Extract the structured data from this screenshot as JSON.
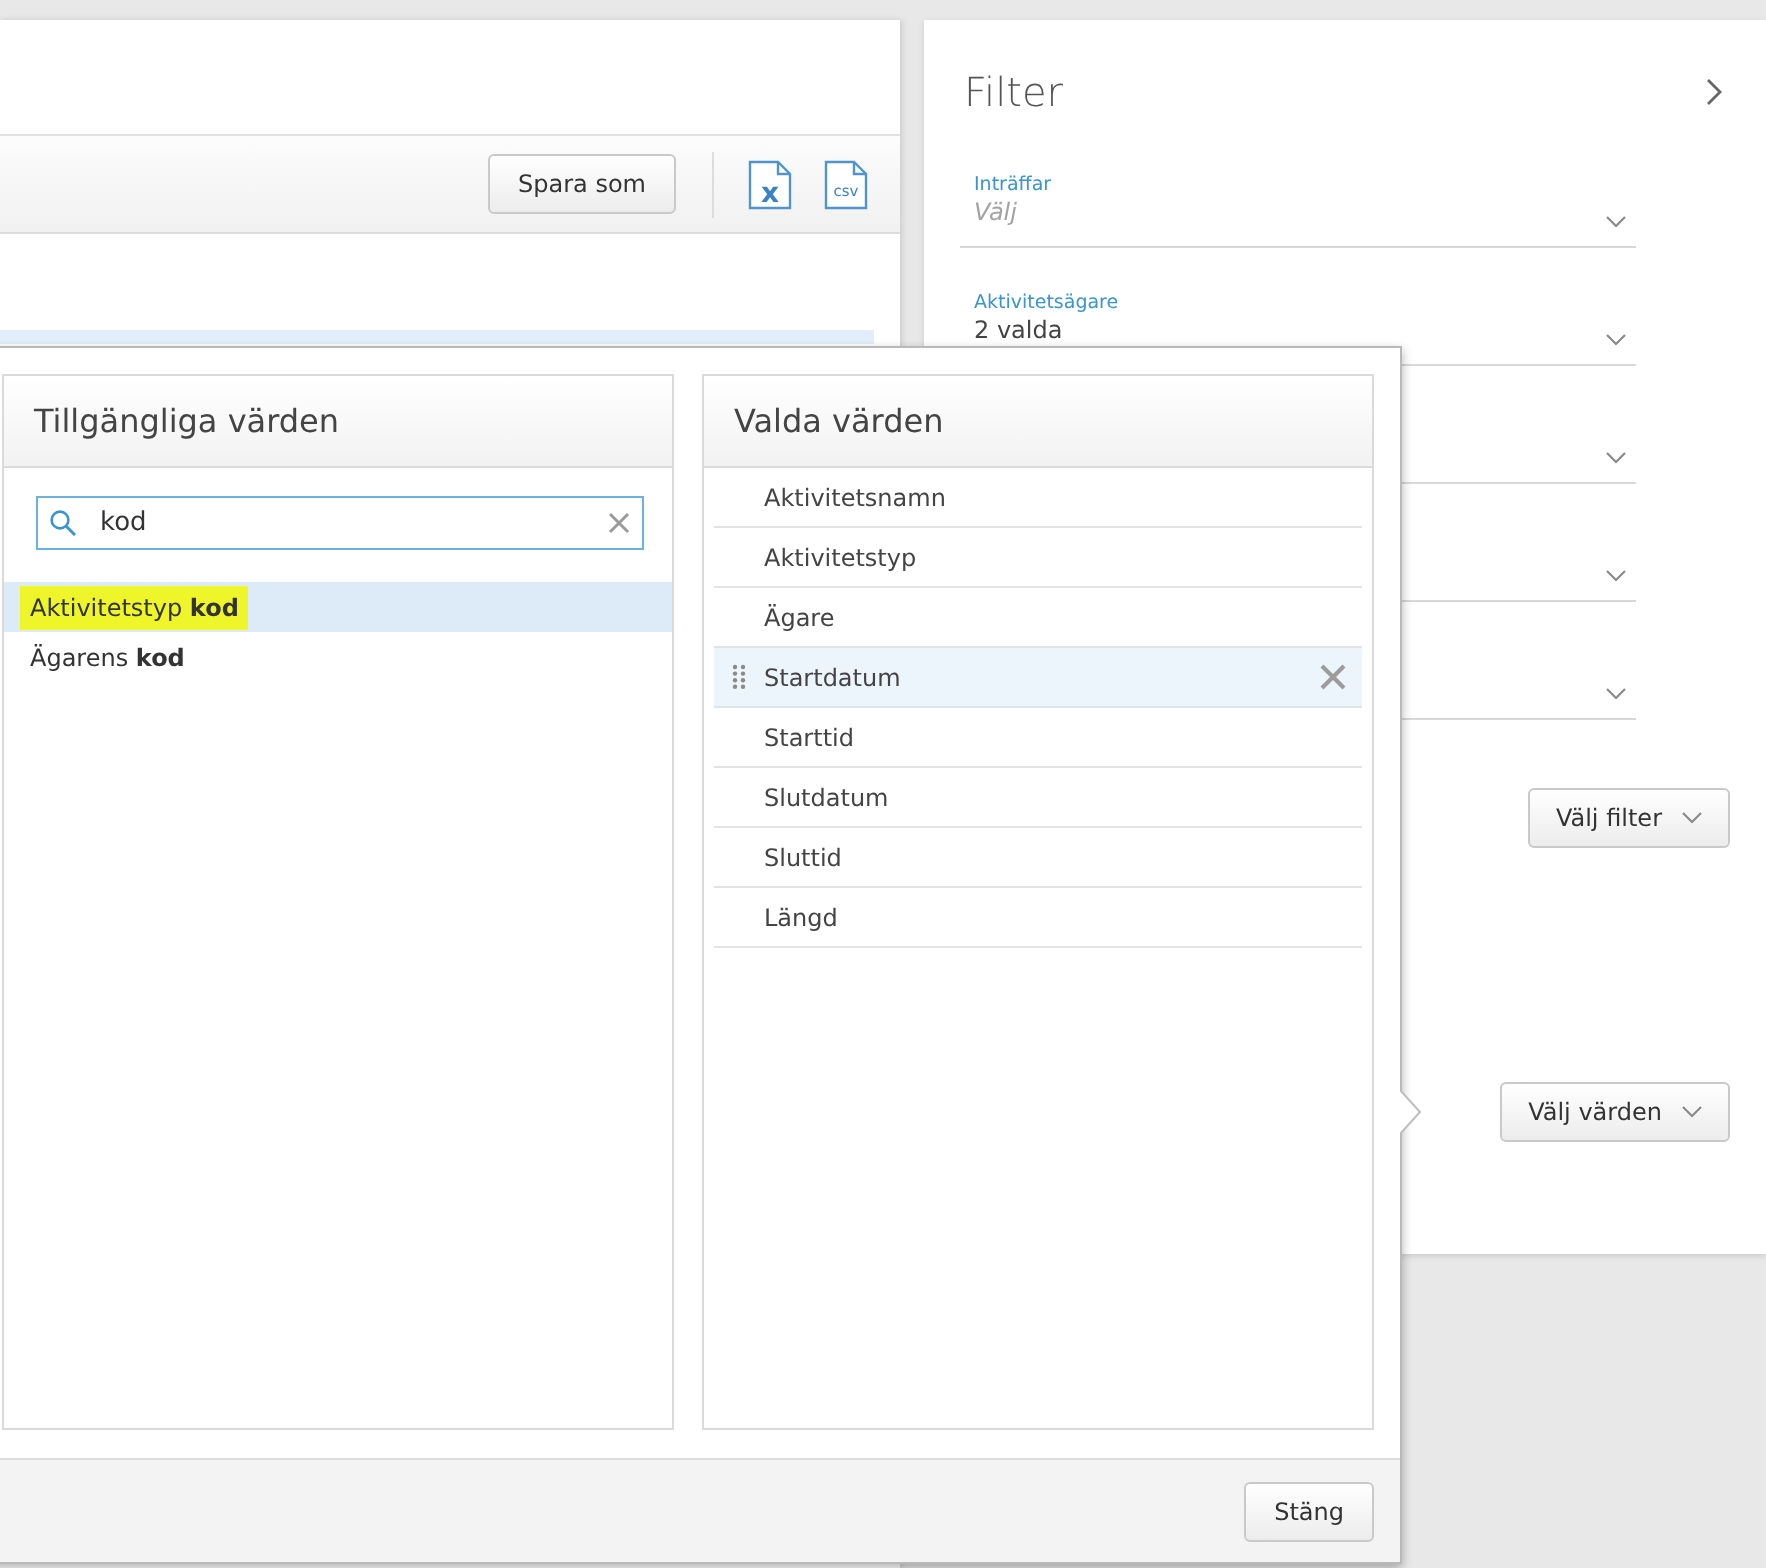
{
  "main": {
    "toolbar": {
      "save_button": "Spara som",
      "exports": [
        {
          "kind": "excel",
          "label": "x"
        },
        {
          "kind": "csv",
          "label": "csv"
        }
      ]
    },
    "table": {
      "rows": [
        {
          "selected": true
        }
      ]
    }
  },
  "filter": {
    "title": "Filter",
    "fields": [
      {
        "kind": "select",
        "label": "Inträffar",
        "placeholder": "Välj"
      },
      {
        "kind": "select",
        "label": "Aktivitetsägare",
        "value": "2 valda"
      },
      {
        "kind": "select"
      },
      {
        "kind": "select"
      },
      {
        "kind": "select"
      }
    ],
    "filter_button": "Välj filter",
    "values_button": "Välj värden"
  },
  "values_dialog": {
    "available": {
      "title": "Tillgängliga värden",
      "search": {
        "value": "kod"
      },
      "items": [
        {
          "text": "Aktivitetstyp **kod**",
          "selected": true,
          "marked": true
        },
        {
          "text": "Ägarens **kod**",
          "selected": false,
          "marked": false
        }
      ]
    },
    "chosen": {
      "title": "Valda värden",
      "items": [
        {
          "text": "Aktivitetsnamn",
          "selected": false
        },
        {
          "text": "Aktivitetstyp",
          "selected": false
        },
        {
          "text": "Ägare",
          "selected": false
        },
        {
          "text": "Startdatum",
          "selected": true
        },
        {
          "text": "Starttid",
          "selected": false
        },
        {
          "text": "Slutdatum",
          "selected": false
        },
        {
          "text": "Sluttid",
          "selected": false
        },
        {
          "text": "Längd",
          "selected": false
        }
      ]
    },
    "close_button": "Stäng"
  }
}
